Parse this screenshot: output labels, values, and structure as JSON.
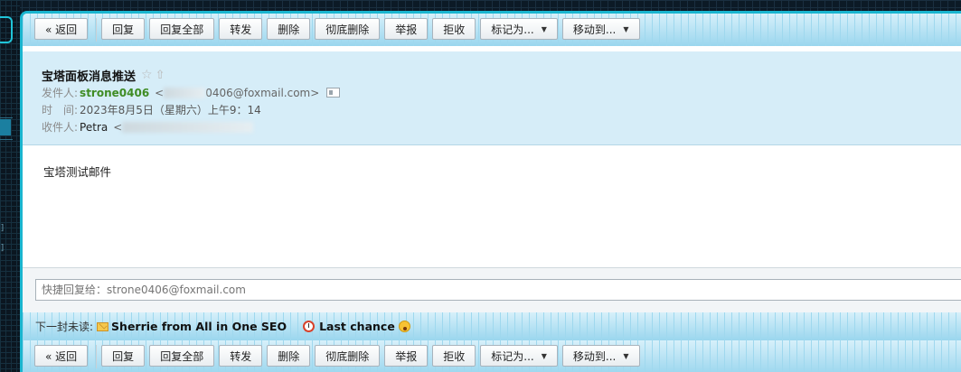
{
  "toolbar": {
    "back": "« 返回",
    "reply": "回复",
    "reply_all": "回复全部",
    "forward": "转发",
    "delete": "删除",
    "delete_permanently": "彻底删除",
    "report": "举报",
    "reject": "拒收",
    "mark_as": "标记为...",
    "move_to": "移动到..."
  },
  "message": {
    "subject": "宝塔面板消息推送",
    "from_label": "发件人:",
    "from_name": "strone0406",
    "from_addr_prefix": "<",
    "from_addr_suffix": "0406@foxmail.com>",
    "time_label": "时　间:",
    "time_value": "2023年8月5日（星期六）上午9：14",
    "to_label": "收件人:",
    "to_name": "Petra",
    "to_addr_prefix": "<",
    "body": "宝塔测试邮件"
  },
  "quick_reply": {
    "placeholder": "快捷回复给：strone0406@foxmail.com"
  },
  "next_unread": {
    "label": "下一封未读:",
    "items": [
      {
        "subject": "Sherrie from All in One SEO",
        "icon": "envelope-icon"
      },
      {
        "subject": "Last chance",
        "icon": "alarm-clock-icon"
      }
    ]
  },
  "icons": {
    "star": "☆",
    "up": "⇧"
  },
  "colors": {
    "accent": "#1ab5cf",
    "header_bg": "#d6edf8",
    "sender_green": "#3f8c24"
  }
}
